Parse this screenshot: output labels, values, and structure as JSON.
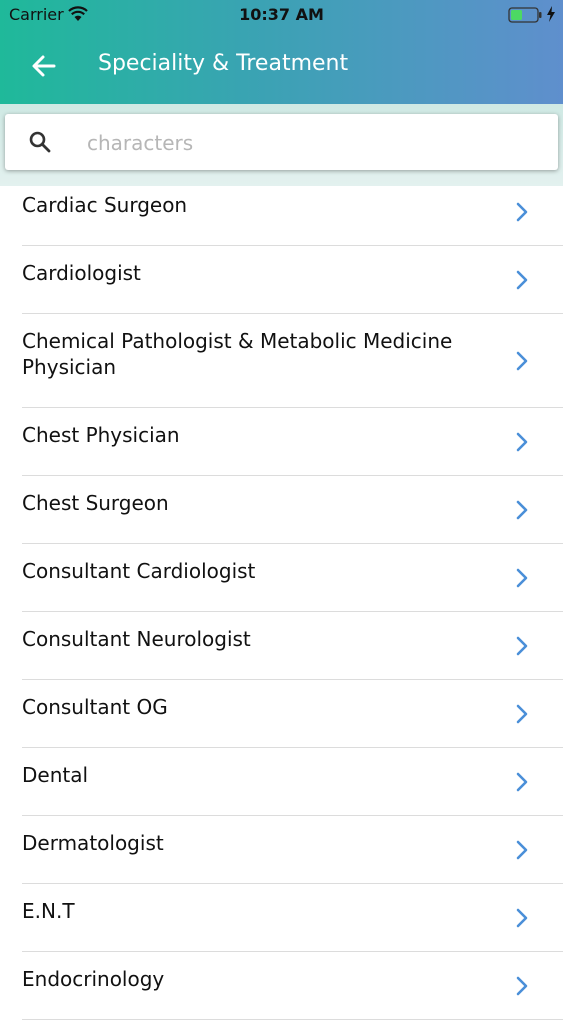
{
  "status_bar": {
    "carrier": "Carrier",
    "time": "10:37 AM"
  },
  "header": {
    "title": "Speciality & Treatment"
  },
  "search": {
    "placeholder": "characters",
    "value": ""
  },
  "colors": {
    "header_start": "#1fb99a",
    "header_end": "#5f8fcd",
    "chevron": "#4a8fd8"
  },
  "icons": [
    "back-arrow-icon",
    "search-icon",
    "chevron-right-icon",
    "wifi-icon",
    "battery-icon"
  ],
  "specialities": [
    "Cardiac Surgeon",
    "Cardiologist",
    "Chemical Pathologist & Metabolic Medicine Physician",
    "Chest Physician",
    "Chest Surgeon",
    "Consultant Cardiologist",
    "Consultant Neurologist",
    "Consultant OG",
    "Dental",
    "Dermatologist",
    "E.N.T",
    "Endocrinology"
  ]
}
